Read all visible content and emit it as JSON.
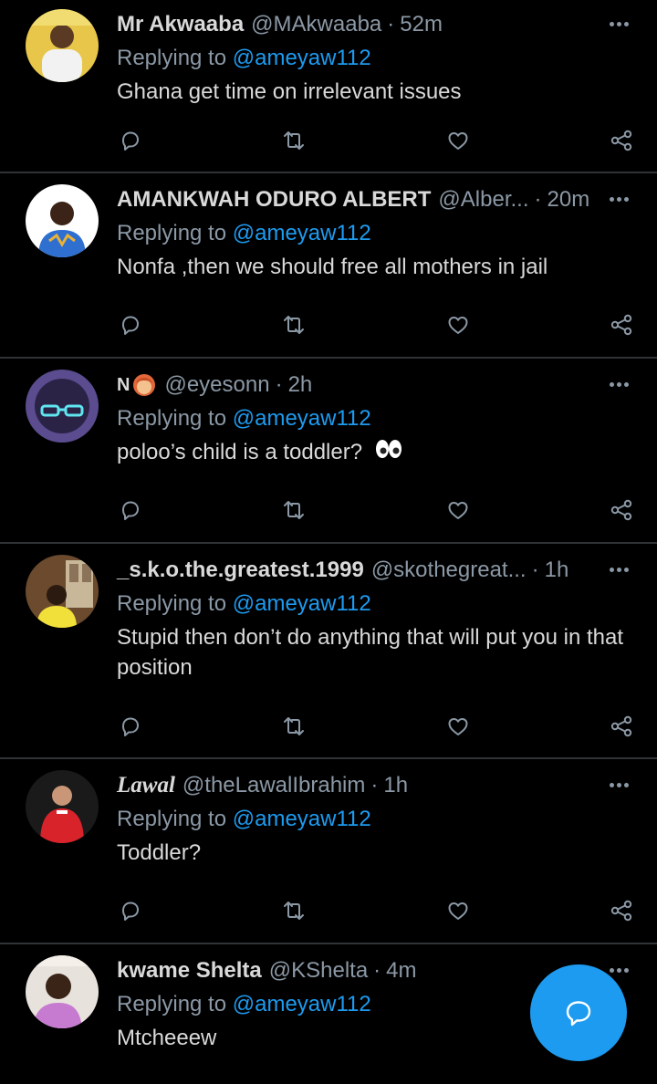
{
  "tweets": [
    {
      "name": "Mr Akwaaba",
      "handle": "@MAkwaaba",
      "time": "52m",
      "replying_label": "Replying to",
      "mention": "@ameyaw112",
      "text": "Ghana get time on irrelevant issues"
    },
    {
      "name": "AMANKWAH ODURO ALBERT",
      "handle": "@Alber...",
      "time": "20m",
      "replying_label": "Replying to",
      "mention": "@ameyaw112",
      "text": "Nonfa ,then we should free all mothers in jail"
    },
    {
      "name": "N",
      "handle": "@eyesonn",
      "time": "2h",
      "replying_label": "Replying to",
      "mention": "@ameyaw112",
      "text": "poloo’s child is a toddler?"
    },
    {
      "name": "_s.k.o.the.greatest.1999",
      "handle": "@skothegreat...",
      "time": "1h",
      "replying_label": "Replying to",
      "mention": "@ameyaw112",
      "text": "Stupid then don’t do anything that will put you in that position"
    },
    {
      "name": "Lawal",
      "handle": "@theLawalIbrahim",
      "time": "1h",
      "replying_label": "Replying to",
      "mention": "@ameyaw112",
      "text": "Toddler?"
    },
    {
      "name": "kwame Shelta",
      "handle": "@KShelta",
      "time": "4m",
      "replying_label": "Replying to",
      "mention": "@ameyaw112",
      "text": "Mtcheeew"
    }
  ],
  "icons": {
    "reply": "reply-icon",
    "retweet": "retweet-icon",
    "like": "heart-icon",
    "share": "share-icon",
    "more": "more-icon",
    "compose": "compose-reply-icon"
  },
  "colors": {
    "background": "#000000",
    "accent": "#1d9bf0",
    "secondary_text": "#8b98a5",
    "primary_text": "#d9d9d9",
    "divider": "#2f3336"
  }
}
